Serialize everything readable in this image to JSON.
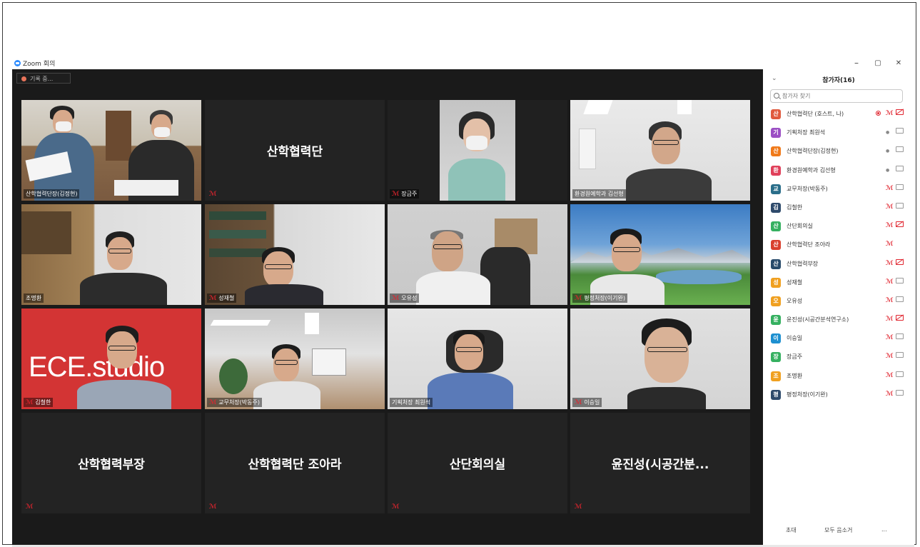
{
  "window": {
    "title": "Zoom 회의",
    "minimize": "–",
    "restore": "▢",
    "close": "✕"
  },
  "recording": {
    "label": "기록 중..."
  },
  "tiles": [
    {
      "name": "산학협력단장(김정현)",
      "video": true,
      "active": true
    },
    {
      "name": "산학협력단",
      "video": false,
      "center_label": "산학협력단"
    },
    {
      "name": "장금주",
      "video": true
    },
    {
      "name": "환경원예학과 김선형",
      "video": true
    },
    {
      "name": "조명환",
      "video": true
    },
    {
      "name": "성재철",
      "video": true
    },
    {
      "name": "오유성",
      "video": true
    },
    {
      "name": "평정처장(이기완)",
      "video": true
    },
    {
      "name": "김철한",
      "video": true,
      "backdrop_text": "ECE.studio"
    },
    {
      "name": "교무처장(박동주)",
      "video": true
    },
    {
      "name": "기획처장 최원석",
      "video": true
    },
    {
      "name": "이승일",
      "video": true
    },
    {
      "name": "산학협력부장",
      "video": false,
      "center_label": "산학협력부장"
    },
    {
      "name": "산학협력단 조아라",
      "video": false,
      "center_label": "산학협력단 조아라"
    },
    {
      "name": "산단회의실",
      "video": false,
      "center_label": "산단회의실"
    },
    {
      "name": "윤진성(시공간분…",
      "video": false,
      "center_label": "윤진성(시공간분..."
    }
  ],
  "participants_panel": {
    "title": "참가자(16)",
    "search_placeholder": "참가자 찾기",
    "items": [
      {
        "initial": "산",
        "name": "산학협력단 (호스트, 나)",
        "color": "#e05a3d",
        "mic": "muted",
        "cam": "off",
        "recording": true
      },
      {
        "initial": "기",
        "name": "기획처장 최원석",
        "color": "#9b4fc4",
        "mic": "on",
        "cam": "on"
      },
      {
        "initial": "산",
        "name": "산학협력단장(김정현)",
        "color": "#f07a1a",
        "mic": "on",
        "cam": "on"
      },
      {
        "initial": "환",
        "name": "환경원예학과 김선형",
        "color": "#e0405a",
        "mic": "on",
        "cam": "on"
      },
      {
        "initial": "교",
        "name": "교무처장(박동주)",
        "color": "#2a6e8a",
        "mic": "muted",
        "cam": "on"
      },
      {
        "initial": "김",
        "name": "김철한",
        "color": "#2e4a6b",
        "mic": "muted",
        "cam": "on"
      },
      {
        "initial": "산",
        "name": "산단회의실",
        "color": "#35b060",
        "mic": "muted",
        "cam": "off"
      },
      {
        "initial": "산",
        "name": "산학협력단 조아라",
        "color": "#d9402e",
        "mic": "muted",
        "cam": "none"
      },
      {
        "initial": "산",
        "name": "산학협력부장",
        "color": "#274a6a",
        "mic": "muted",
        "cam": "off"
      },
      {
        "initial": "성",
        "name": "성재철",
        "color": "#f0a020",
        "mic": "muted",
        "cam": "on"
      },
      {
        "initial": "오",
        "name": "오유성",
        "color": "#f0a020",
        "mic": "muted",
        "cam": "on"
      },
      {
        "initial": "윤",
        "name": "윤진성(시공간분석연구소)",
        "color": "#35b060",
        "mic": "muted",
        "cam": "off"
      },
      {
        "initial": "이",
        "name": "이승일",
        "color": "#1e90d0",
        "mic": "muted",
        "cam": "on"
      },
      {
        "initial": "장",
        "name": "장금주",
        "color": "#35b060",
        "mic": "muted",
        "cam": "on"
      },
      {
        "initial": "조",
        "name": "조명환",
        "color": "#f0a020",
        "mic": "muted",
        "cam": "on"
      },
      {
        "initial": "평",
        "name": "평정처장(이기완)",
        "color": "#2e4a6b",
        "mic": "muted",
        "cam": "on"
      }
    ],
    "footer": {
      "invite": "초대",
      "mute_all": "모두 음소거",
      "more": "..."
    }
  },
  "colors": {
    "meeting_bg": "#1a1a1a",
    "active_speaker": "#c3e65a",
    "muted_red": "#e0242e"
  }
}
